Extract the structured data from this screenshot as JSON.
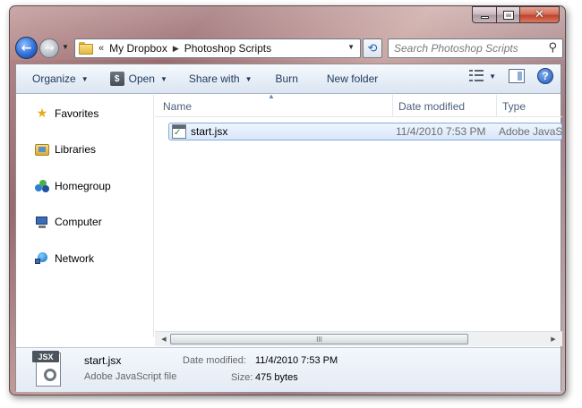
{
  "window": {
    "close_glyph": "✕"
  },
  "nav": {
    "back_glyph": "←",
    "forward_glyph": "→",
    "breadcrumb_prefix": "«",
    "breadcrumbs": [
      "My Dropbox",
      "Photoshop Scripts"
    ],
    "refresh_glyph": "⟲"
  },
  "search": {
    "placeholder": "Search Photoshop Scripts",
    "icon": "search-icon"
  },
  "toolbar": {
    "organize": "Organize",
    "open": "Open",
    "share_with": "Share with",
    "burn": "Burn",
    "new_folder": "New folder",
    "help": "?"
  },
  "sidebar": {
    "items": [
      {
        "label": "Favorites",
        "icon": "star-icon"
      },
      {
        "label": "Libraries",
        "icon": "libraries-icon"
      },
      {
        "label": "Homegroup",
        "icon": "homegroup-icon"
      },
      {
        "label": "Computer",
        "icon": "computer-icon"
      },
      {
        "label": "Network",
        "icon": "network-icon"
      }
    ]
  },
  "columns": {
    "name": "Name",
    "date_modified": "Date modified",
    "type": "Type"
  },
  "files": [
    {
      "name": "start.jsx",
      "date_modified": "11/4/2010 7:53 PM",
      "type": "Adobe JavaScript file"
    }
  ],
  "scrollbar": {
    "grip": "III"
  },
  "details": {
    "icon_label": "JSX",
    "name": "start.jsx",
    "type": "Adobe JavaScript file",
    "date_label": "Date modified:",
    "date_value": "11/4/2010 7:53 PM",
    "size_label": "Size:",
    "size_value": "475 bytes"
  },
  "colors": {
    "selection_border": "#84acdd",
    "toolbar_text": "#1e395b",
    "header_text": "#4c607a"
  }
}
